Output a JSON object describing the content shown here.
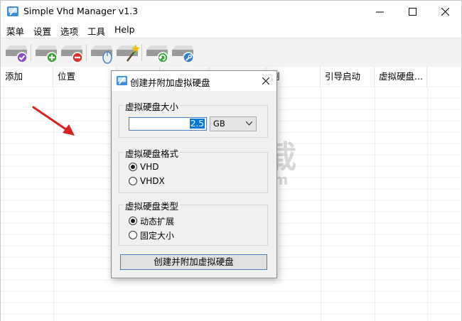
{
  "window": {
    "title": "Simple Vhd Manager v1.3",
    "controls": {
      "minimize": "—",
      "maximize": "☐",
      "close": "✕"
    }
  },
  "menubar": {
    "items": [
      "菜单",
      "设置",
      "选项",
      "工具",
      "Help"
    ]
  },
  "toolbar": {
    "buttons": [
      {
        "icon": "disk-check-icon",
        "badge_color": "#8e4fc6"
      },
      {
        "icon": "disk-add-icon",
        "badge_color": "#3aa63a"
      },
      {
        "icon": "disk-remove-icon",
        "badge_color": "#d9342b"
      },
      {
        "icon": "disk-mouse-icon",
        "badge_color": "#4a7ec2"
      },
      {
        "icon": "disk-magic-icon",
        "badge_color": "#f2b90f"
      },
      {
        "icon": "disk-refresh-icon",
        "badge_color": "#3aa63a"
      },
      {
        "icon": "disk-settings-icon",
        "badge_color": "#2f7bd6"
      }
    ]
  },
  "list": {
    "columns": [
      "添加",
      "位置",
      "",
      "",
      "",
      "剩",
      "引导启动",
      "虚拟硬盘..."
    ]
  },
  "dialog": {
    "title": "创建并附加虚拟硬盘",
    "close_label": "✕",
    "size_group": {
      "label": "虚拟硬盘大小",
      "value": "2.5",
      "unit": "GB"
    },
    "format_group": {
      "label": "虚拟硬盘格式",
      "options": [
        {
          "label": "VHD",
          "selected": true
        },
        {
          "label": "VHDX",
          "selected": false
        }
      ]
    },
    "type_group": {
      "label": "虚拟硬盘类型",
      "options": [
        {
          "label": "动态扩展",
          "selected": true
        },
        {
          "label": "固定大小",
          "selected": false
        }
      ]
    },
    "create_button": "创建并附加虚拟硬盘"
  },
  "watermark": {
    "text_cn": "安下载",
    "text_en": "anxz.com"
  },
  "colors": {
    "accent": "#0078d7",
    "arrow": "#d92323"
  }
}
